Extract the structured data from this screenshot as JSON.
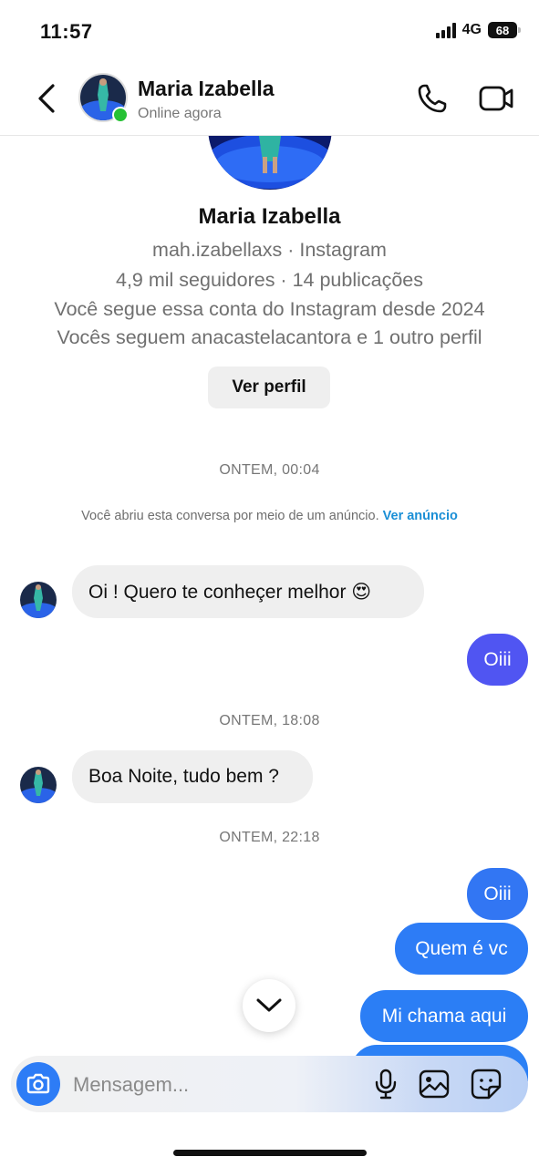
{
  "status_bar": {
    "time": "11:57",
    "network": "4G",
    "battery": "68"
  },
  "header": {
    "name": "Maria Izabella",
    "status": "Online agora"
  },
  "profile": {
    "name": "Maria Izabella",
    "handle_line": "mah.izabellaxs · Instagram",
    "stats_line": "4,9 mil seguidores · 14 publicações",
    "follow_since": "Você segue essa conta do Instagram desde 2024",
    "mutual": "Vocês seguem anacastelacantora e 1 outro perfil",
    "view_button": "Ver perfil"
  },
  "conversation": {
    "timestamp_1": "ONTEM, 00:04",
    "ad_note_text": "Você abriu esta conversa por meio de um anúncio.",
    "ad_note_link": "Ver anúncio",
    "timestamp_2": "ONTEM, 18:08",
    "timestamp_3": "ONTEM, 22:18",
    "messages": [
      {
        "from": "them",
        "text": "Oi ! Quero te conheçer melhor 😍"
      },
      {
        "from": "me",
        "text": "Oiii"
      },
      {
        "from": "them",
        "text": "Boa Noite, tudo bem ?"
      },
      {
        "from": "me",
        "text": "Oiii"
      },
      {
        "from": "me",
        "text": "Quem é vc"
      },
      {
        "from": "me",
        "text": "Mi chama aqui"
      }
    ]
  },
  "composer": {
    "placeholder": "Mensagem..."
  },
  "colors": {
    "accent": "#2d7cf6",
    "bubble_out_purple": "#5055f2",
    "bubble_out_blue": "#2b7ef5",
    "bubble_in": "#efefef",
    "online": "#26c135",
    "link": "#1b8fd6"
  },
  "icons": [
    "back-chevron-icon",
    "phone-icon",
    "video-icon",
    "camera-icon",
    "microphone-icon",
    "image-icon",
    "sticker-icon",
    "chevron-down-icon"
  ]
}
